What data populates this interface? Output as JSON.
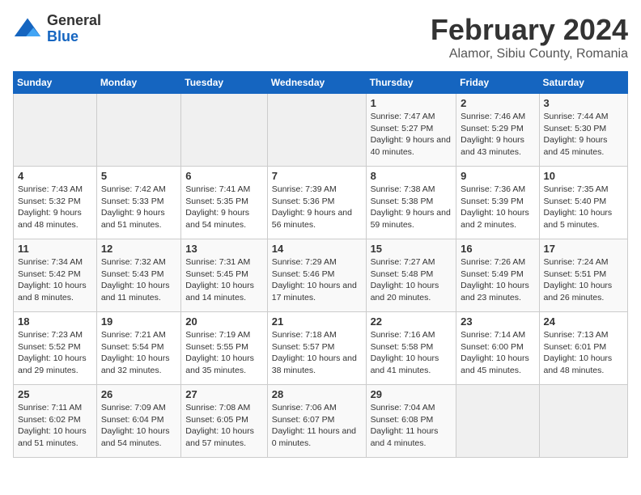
{
  "header": {
    "logo_general": "General",
    "logo_blue": "Blue",
    "title": "February 2024",
    "subtitle": "Alamor, Sibiu County, Romania"
  },
  "days_of_week": [
    "Sunday",
    "Monday",
    "Tuesday",
    "Wednesday",
    "Thursday",
    "Friday",
    "Saturday"
  ],
  "weeks": [
    {
      "days": [
        {
          "num": "",
          "content": ""
        },
        {
          "num": "",
          "content": ""
        },
        {
          "num": "",
          "content": ""
        },
        {
          "num": "",
          "content": ""
        },
        {
          "num": "1",
          "content": "Sunrise: 7:47 AM\nSunset: 5:27 PM\nDaylight: 9 hours and 40 minutes."
        },
        {
          "num": "2",
          "content": "Sunrise: 7:46 AM\nSunset: 5:29 PM\nDaylight: 9 hours and 43 minutes."
        },
        {
          "num": "3",
          "content": "Sunrise: 7:44 AM\nSunset: 5:30 PM\nDaylight: 9 hours and 45 minutes."
        }
      ]
    },
    {
      "days": [
        {
          "num": "4",
          "content": "Sunrise: 7:43 AM\nSunset: 5:32 PM\nDaylight: 9 hours and 48 minutes."
        },
        {
          "num": "5",
          "content": "Sunrise: 7:42 AM\nSunset: 5:33 PM\nDaylight: 9 hours and 51 minutes."
        },
        {
          "num": "6",
          "content": "Sunrise: 7:41 AM\nSunset: 5:35 PM\nDaylight: 9 hours and 54 minutes."
        },
        {
          "num": "7",
          "content": "Sunrise: 7:39 AM\nSunset: 5:36 PM\nDaylight: 9 hours and 56 minutes."
        },
        {
          "num": "8",
          "content": "Sunrise: 7:38 AM\nSunset: 5:38 PM\nDaylight: 9 hours and 59 minutes."
        },
        {
          "num": "9",
          "content": "Sunrise: 7:36 AM\nSunset: 5:39 PM\nDaylight: 10 hours and 2 minutes."
        },
        {
          "num": "10",
          "content": "Sunrise: 7:35 AM\nSunset: 5:40 PM\nDaylight: 10 hours and 5 minutes."
        }
      ]
    },
    {
      "days": [
        {
          "num": "11",
          "content": "Sunrise: 7:34 AM\nSunset: 5:42 PM\nDaylight: 10 hours and 8 minutes."
        },
        {
          "num": "12",
          "content": "Sunrise: 7:32 AM\nSunset: 5:43 PM\nDaylight: 10 hours and 11 minutes."
        },
        {
          "num": "13",
          "content": "Sunrise: 7:31 AM\nSunset: 5:45 PM\nDaylight: 10 hours and 14 minutes."
        },
        {
          "num": "14",
          "content": "Sunrise: 7:29 AM\nSunset: 5:46 PM\nDaylight: 10 hours and 17 minutes."
        },
        {
          "num": "15",
          "content": "Sunrise: 7:27 AM\nSunset: 5:48 PM\nDaylight: 10 hours and 20 minutes."
        },
        {
          "num": "16",
          "content": "Sunrise: 7:26 AM\nSunset: 5:49 PM\nDaylight: 10 hours and 23 minutes."
        },
        {
          "num": "17",
          "content": "Sunrise: 7:24 AM\nSunset: 5:51 PM\nDaylight: 10 hours and 26 minutes."
        }
      ]
    },
    {
      "days": [
        {
          "num": "18",
          "content": "Sunrise: 7:23 AM\nSunset: 5:52 PM\nDaylight: 10 hours and 29 minutes."
        },
        {
          "num": "19",
          "content": "Sunrise: 7:21 AM\nSunset: 5:54 PM\nDaylight: 10 hours and 32 minutes."
        },
        {
          "num": "20",
          "content": "Sunrise: 7:19 AM\nSunset: 5:55 PM\nDaylight: 10 hours and 35 minutes."
        },
        {
          "num": "21",
          "content": "Sunrise: 7:18 AM\nSunset: 5:57 PM\nDaylight: 10 hours and 38 minutes."
        },
        {
          "num": "22",
          "content": "Sunrise: 7:16 AM\nSunset: 5:58 PM\nDaylight: 10 hours and 41 minutes."
        },
        {
          "num": "23",
          "content": "Sunrise: 7:14 AM\nSunset: 6:00 PM\nDaylight: 10 hours and 45 minutes."
        },
        {
          "num": "24",
          "content": "Sunrise: 7:13 AM\nSunset: 6:01 PM\nDaylight: 10 hours and 48 minutes."
        }
      ]
    },
    {
      "days": [
        {
          "num": "25",
          "content": "Sunrise: 7:11 AM\nSunset: 6:02 PM\nDaylight: 10 hours and 51 minutes."
        },
        {
          "num": "26",
          "content": "Sunrise: 7:09 AM\nSunset: 6:04 PM\nDaylight: 10 hours and 54 minutes."
        },
        {
          "num": "27",
          "content": "Sunrise: 7:08 AM\nSunset: 6:05 PM\nDaylight: 10 hours and 57 minutes."
        },
        {
          "num": "28",
          "content": "Sunrise: 7:06 AM\nSunset: 6:07 PM\nDaylight: 11 hours and 0 minutes."
        },
        {
          "num": "29",
          "content": "Sunrise: 7:04 AM\nSunset: 6:08 PM\nDaylight: 11 hours and 4 minutes."
        },
        {
          "num": "",
          "content": ""
        },
        {
          "num": "",
          "content": ""
        }
      ]
    }
  ]
}
